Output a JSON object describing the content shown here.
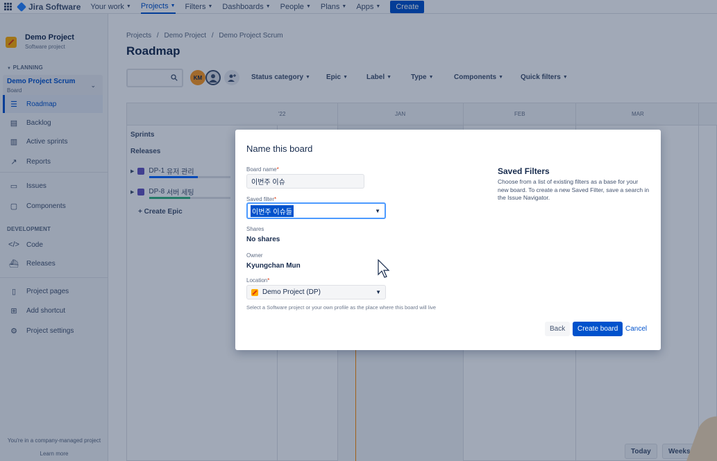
{
  "topnav": {
    "brand": "Jira Software",
    "items": [
      {
        "label": "Your work",
        "active": false
      },
      {
        "label": "Projects",
        "active": true
      },
      {
        "label": "Filters",
        "active": false
      },
      {
        "label": "Dashboards",
        "active": false
      },
      {
        "label": "People",
        "active": false
      },
      {
        "label": "Plans",
        "active": false
      },
      {
        "label": "Apps",
        "active": false
      }
    ],
    "create_label": "Create"
  },
  "sidebar": {
    "project_name": "Demo Project",
    "project_type": "Software project",
    "planning_label": "PLANNING",
    "board_name": "Demo Project Scrum",
    "board_type": "Board",
    "planning_items": [
      {
        "label": "Roadmap",
        "icon": "roadmap-icon"
      },
      {
        "label": "Backlog",
        "icon": "backlog-icon"
      },
      {
        "label": "Active sprints",
        "icon": "board-icon"
      },
      {
        "label": "Reports",
        "icon": "reports-icon"
      }
    ],
    "other_items": [
      {
        "label": "Issues",
        "icon": "issues-icon"
      },
      {
        "label": "Components",
        "icon": "components-icon"
      }
    ],
    "development_label": "DEVELOPMENT",
    "development_items": [
      {
        "label": "Code",
        "icon": "code-icon"
      },
      {
        "label": "Releases",
        "icon": "releases-icon"
      }
    ],
    "bottom_items": [
      {
        "label": "Project pages",
        "icon": "pages-icon"
      },
      {
        "label": "Add shortcut",
        "icon": "add-shortcut-icon"
      },
      {
        "label": "Project settings",
        "icon": "gear-icon"
      }
    ],
    "footer_text": "You're in a company-managed project",
    "learn_more": "Learn more"
  },
  "main": {
    "breadcrumb": [
      "Projects",
      "Demo Project",
      "Demo Project Scrum"
    ],
    "breadcrumb_sep": "/",
    "title": "Roadmap",
    "avatar_initials": "KM",
    "filters": [
      "Status category",
      "Epic",
      "Label",
      "Type",
      "Components",
      "Quick filters"
    ],
    "months": [
      "'22",
      "JAN",
      "FEB",
      "MAR"
    ],
    "rows": {
      "sprints": "Sprints",
      "releases": "Releases"
    },
    "epics": [
      {
        "key": "DP-1",
        "name": "유저 관리",
        "progress": 0.6,
        "color": "#0065ff"
      },
      {
        "key": "DP-8",
        "name": "서버 세팅",
        "progress": 0.5,
        "color": "#36b37e"
      }
    ],
    "create_epic": "+ Create Epic",
    "bottom_buttons": [
      "Today",
      "Weeks"
    ]
  },
  "modal": {
    "title": "Name this board",
    "board_name_label": "Board name",
    "board_name_value": "이번주 이슈",
    "saved_filter_label": "Saved filter",
    "saved_filter_value": "이번주 이슈들",
    "shares_label": "Shares",
    "shares_value": "No shares",
    "owner_label": "Owner",
    "owner_value": "Kyungchan Mun",
    "location_label": "Location",
    "location_value": "Demo Project (DP)",
    "location_help": "Select a Software project or your own profile as the place where this board will live",
    "side_title": "Saved Filters",
    "side_desc": "Choose from a list of existing filters as a base for your new board. To create a new Saved Filter, save a search in the Issue Navigator.",
    "back_label": "Back",
    "create_label": "Create board",
    "cancel_label": "Cancel",
    "required_mark": "*"
  }
}
